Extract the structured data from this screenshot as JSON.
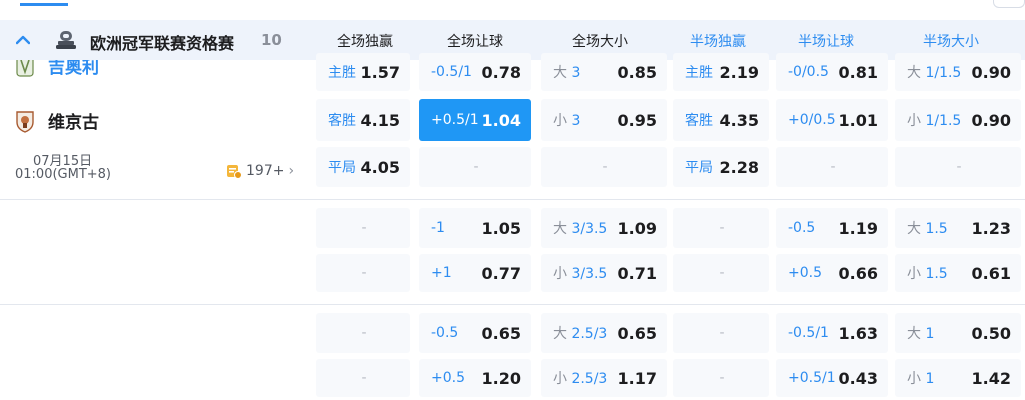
{
  "league": {
    "name": "欧洲冠军联赛资格赛",
    "count": "10"
  },
  "columns": [
    "全场独赢",
    "全场让球",
    "全场大小",
    "半场独赢",
    "半场让球",
    "半场大小"
  ],
  "match": {
    "home_team": "吉奥利",
    "away_team": "维京古",
    "date": "07月15日",
    "time": "01:00(GMT+8)",
    "more_markets": "197+"
  },
  "rows": [
    [
      {
        "label": "主胜",
        "value": "1.57"
      },
      {
        "label": "-0.5/1",
        "value": "0.78"
      },
      {
        "prefix": "大",
        "label": "3",
        "value": "0.85"
      },
      {
        "label": "主胜",
        "value": "2.19"
      },
      {
        "label": "-0/0.5",
        "value": "0.81"
      },
      {
        "prefix": "大",
        "label": "1/1.5",
        "value": "0.90"
      }
    ],
    [
      {
        "label": "客胜",
        "value": "4.15"
      },
      {
        "label": "+0.5/1",
        "value": "1.04",
        "active": true
      },
      {
        "prefix": "小",
        "label": "3",
        "value": "0.95"
      },
      {
        "label": "客胜",
        "value": "4.35"
      },
      {
        "label": "+0/0.5",
        "value": "1.01"
      },
      {
        "prefix": "小",
        "label": "1/1.5",
        "value": "0.90"
      }
    ],
    [
      {
        "label": "平局",
        "value": "4.05"
      },
      {
        "empty": "-"
      },
      {
        "empty": "-"
      },
      {
        "label": "平局",
        "value": "2.28"
      },
      {
        "empty": "-"
      },
      {
        "empty": "-"
      }
    ],
    [
      {
        "empty": "-"
      },
      {
        "label": "-1",
        "value": "1.05"
      },
      {
        "prefix": "大",
        "label": "3/3.5",
        "value": "1.09"
      },
      {
        "empty": "-"
      },
      {
        "label": "-0.5",
        "value": "1.19"
      },
      {
        "prefix": "大",
        "label": "1.5",
        "value": "1.23"
      }
    ],
    [
      {
        "empty": "-"
      },
      {
        "label": "+1",
        "value": "0.77"
      },
      {
        "prefix": "小",
        "label": "3/3.5",
        "value": "0.71"
      },
      {
        "empty": "-"
      },
      {
        "label": "+0.5",
        "value": "0.66"
      },
      {
        "prefix": "小",
        "label": "1.5",
        "value": "0.61"
      }
    ],
    [
      {
        "empty": "-"
      },
      {
        "label": "-0.5",
        "value": "0.65"
      },
      {
        "prefix": "大",
        "label": "2.5/3",
        "value": "0.65"
      },
      {
        "empty": "-"
      },
      {
        "label": "-0.5/1",
        "value": "1.63"
      },
      {
        "prefix": "大",
        "label": "1",
        "value": "0.50"
      }
    ],
    [
      {
        "empty": "-"
      },
      {
        "label": "+0.5",
        "value": "1.20"
      },
      {
        "prefix": "小",
        "label": "2.5/3",
        "value": "1.17"
      },
      {
        "empty": "-"
      },
      {
        "label": "+0.5/1",
        "value": "0.43"
      },
      {
        "prefix": "小",
        "label": "1",
        "value": "1.42"
      }
    ]
  ],
  "colors": {
    "accent": "#2d8cf0",
    "active_cell": "#1f97f5",
    "cell_bg": "#f7f9fc",
    "header_bg": "#eef3fb"
  }
}
